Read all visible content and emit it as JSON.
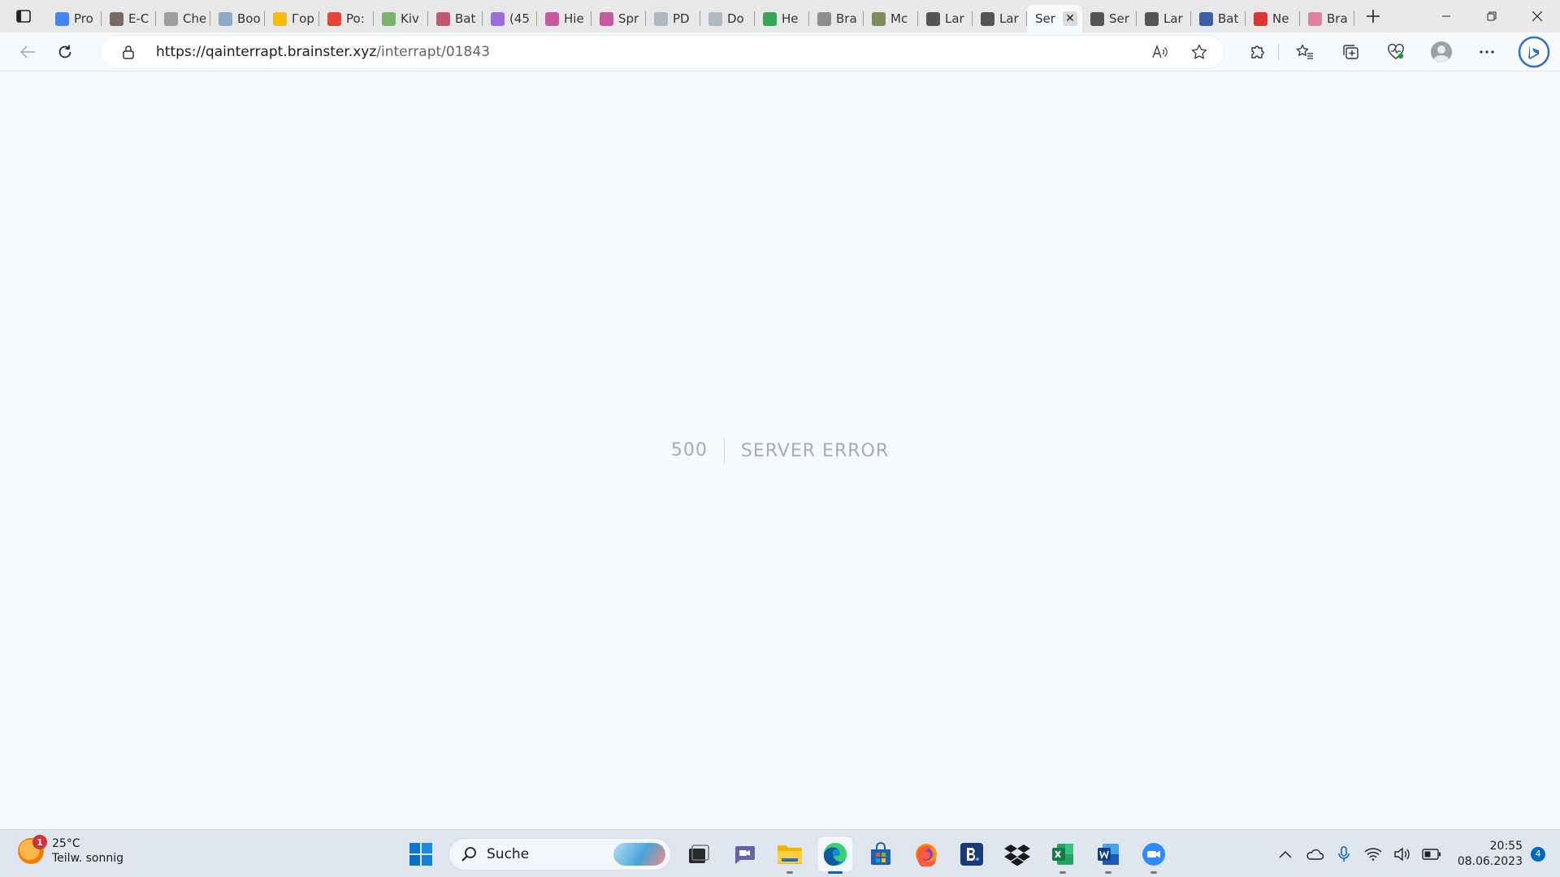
{
  "browser": {
    "tabs": [
      {
        "title": "Pro",
        "icon": "google-icon",
        "color": "#4285f4"
      },
      {
        "title": "E-C",
        "icon": "archive-icon",
        "color": "#7a6a64"
      },
      {
        "title": "Che",
        "icon": "page-icon",
        "color": "#9e9e9e"
      },
      {
        "title": "Boo",
        "icon": "site-icon",
        "color": "#8aa9c8"
      },
      {
        "title": "Гор",
        "icon": "drive-icon",
        "color": "#fbbc04"
      },
      {
        "title": "Po:",
        "icon": "gmail-icon",
        "color": "#ea4335"
      },
      {
        "title": "Kiv",
        "icon": "leaf-icon",
        "color": "#7bb36a"
      },
      {
        "title": "Bat",
        "icon": "circle-icon",
        "color": "#c05a74"
      },
      {
        "title": "(45",
        "icon": "mail-icon",
        "color": "#9b6ddb"
      },
      {
        "title": "Hie",
        "icon": "flower-icon",
        "color": "#c657a0"
      },
      {
        "title": "Spr",
        "icon": "flower-icon",
        "color": "#c657a0"
      },
      {
        "title": "PD",
        "icon": "doc-icon",
        "color": "#b0b7c3"
      },
      {
        "title": "Do",
        "icon": "doc-icon",
        "color": "#b0b7c3"
      },
      {
        "title": "He",
        "icon": "maps-icon",
        "color": "#34a853"
      },
      {
        "title": "Bra",
        "icon": "globe-icon",
        "color": "#8d8d8d"
      },
      {
        "title": "Mc",
        "icon": "ring-icon",
        "color": "#7f8c5a"
      },
      {
        "title": "Lar",
        "icon": "page-icon",
        "color": "#555555"
      },
      {
        "title": "Lar",
        "icon": "page-icon",
        "color": "#555555"
      },
      {
        "title": "Ser",
        "icon": "",
        "color": "#555555",
        "active": true
      },
      {
        "title": "Ser",
        "icon": "page-icon",
        "color": "#555555"
      },
      {
        "title": "Lar",
        "icon": "page-icon",
        "color": "#555555"
      },
      {
        "title": "Bat",
        "icon": "app-icon",
        "color": "#3b5ea8"
      },
      {
        "title": "Ne",
        "icon": "arc-icon",
        "color": "#d33"
      },
      {
        "title": "Bra",
        "icon": "dot-icon",
        "color": "#e07fa0"
      }
    ],
    "url_host": "https://qainterrapt.brainster.xyz",
    "url_path": "/interrapt/01843"
  },
  "page": {
    "error_code": "500",
    "error_message": "Server Error"
  },
  "taskbar": {
    "weather_temp": "25°C",
    "weather_desc": "Teilw. sonnig",
    "weather_badge": "1",
    "search_label": "Suche",
    "time": "20:55",
    "date": "08.06.2023",
    "notification_count": "4"
  },
  "colors": {
    "page_background": "#f7fafc",
    "error_text": "#a0aec0",
    "accent": "#0067c0"
  }
}
